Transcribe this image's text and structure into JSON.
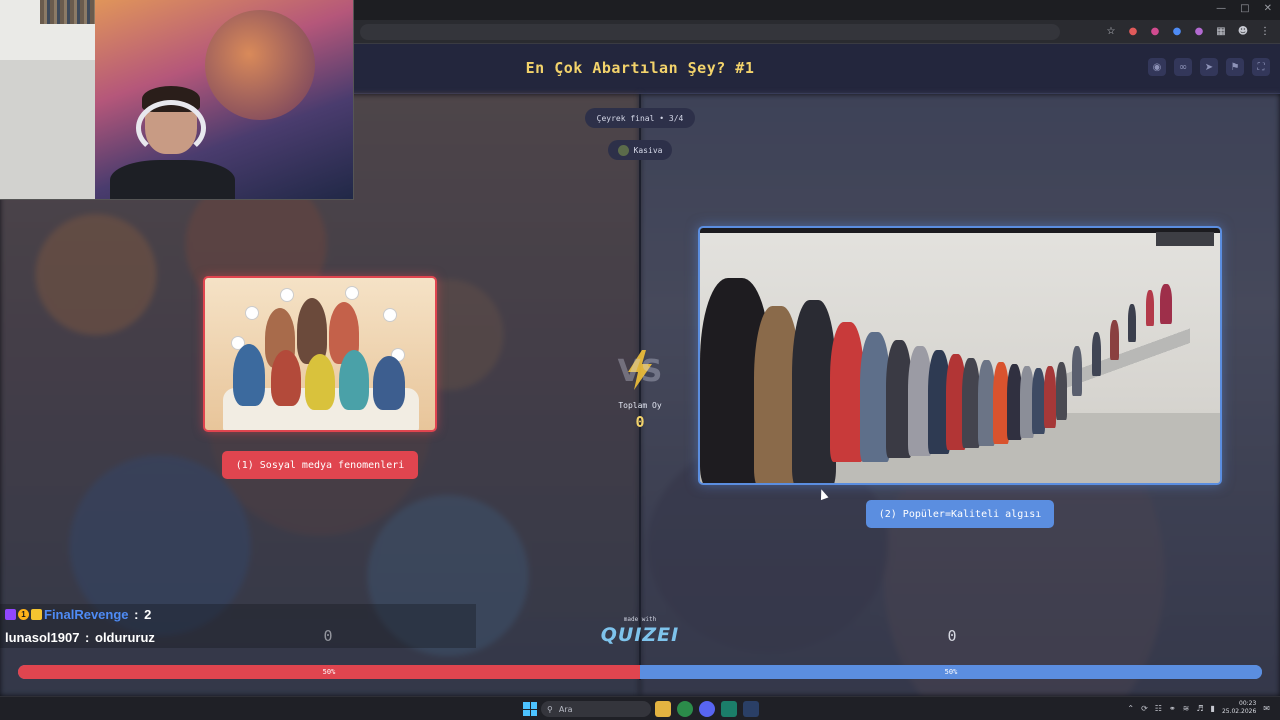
{
  "app": {
    "title": "En Çok Abartılan Şey? #1",
    "header_actions": [
      "eye-icon",
      "link-icon",
      "share-icon",
      "flag-icon",
      "fullscreen-icon"
    ]
  },
  "round": {
    "label": "Çeyrek final • 3/4",
    "creator": "Kasiva"
  },
  "options": [
    {
      "label": "(1) Sosyal medya fenomenleri",
      "votes": "0",
      "percent": "50%",
      "percent_value": 50,
      "color": "#e0454f"
    },
    {
      "label": "(2) Popüler=Kaliteli algısı",
      "votes": "0",
      "percent": "50%",
      "percent_value": 50,
      "color": "#5b8ee0"
    }
  ],
  "center": {
    "vs": "VS",
    "total_label": "Toplam Oy",
    "total_value": "0"
  },
  "branding": {
    "made_with": "made with",
    "logo": "QUIZEI"
  },
  "chat": [
    {
      "user": "FinalRevenge",
      "message": "2",
      "badge_text": "1"
    },
    {
      "user": "lunasol1907",
      "message": "oldururuz"
    }
  ],
  "taskbar": {
    "search_placeholder": "Ara",
    "time": "00:23",
    "date": "25.02.2026"
  },
  "colors": {
    "accent_red": "#e0454f",
    "accent_blue": "#5b8ee0",
    "title_yellow": "#f3d36b",
    "header_bg": "#23263d"
  }
}
